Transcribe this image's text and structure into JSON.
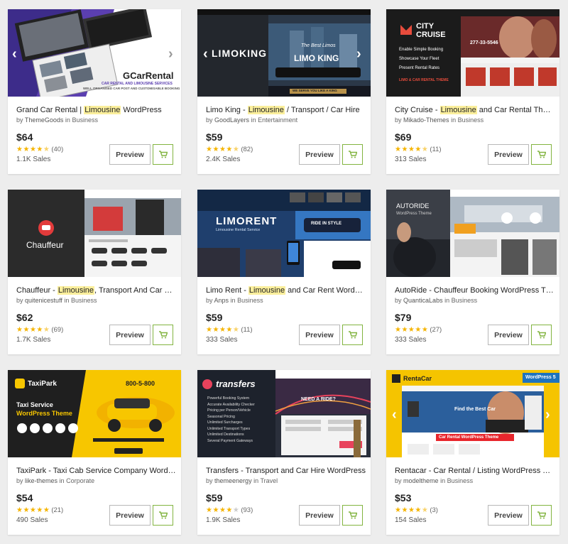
{
  "colors": {
    "accent_green": "#82b440",
    "star": "#f5b400",
    "highlight": "#fbef9c"
  },
  "button_labels": {
    "preview": "Preview",
    "cart_icon": "cart-icon"
  },
  "items": [
    {
      "title_pre": "Grand Car Rental | ",
      "title_hl": "Limousine",
      "title_post": " WordPress",
      "by": "by",
      "author": "ThemeGoods",
      "in": "in",
      "category": "Business",
      "price": "$64",
      "stars": "★★★★★",
      "rating_count": "(40)",
      "sales": "1.1K Sales",
      "rating": 4.5,
      "thumb": {
        "logo": "GCarRental",
        "sub1": "CAR RENTAL AND LIMOUSINE SERVICES",
        "sub2": "WELL ORGANISED CAR POST AND CUSTOMISABLE BOOKING"
      }
    },
    {
      "title_pre": "Limo King - ",
      "title_hl": "Limousine",
      "title_post": " / Transport / Car Hire",
      "by": "by",
      "author": "GoodLayers",
      "in": "in",
      "category": "Entertainment",
      "price": "$59",
      "stars": "★★★★★",
      "rating_count": "(82)",
      "sales": "2.4K Sales",
      "rating": 4.5,
      "thumb": {
        "logo": "LIMOKING",
        "sub1": "The Best Limos",
        "sub2": "LIMO KING",
        "sub3": "WE SERVE YOU LIKE A KING"
      }
    },
    {
      "title_pre": "City Cruise - ",
      "title_hl": "Limousine",
      "title_post": " and Car Rental Theme",
      "by": "by",
      "author": "Mikado-Themes",
      "in": "in",
      "category": "Business",
      "price": "$69",
      "stars": "★★★★★",
      "rating_count": "(11)",
      "sales": "313 Sales",
      "rating": 4.5,
      "thumb": {
        "logo1": "CITY",
        "logo2": "CRUISE",
        "l1": "Enable Simple Booking",
        "l2": "Showcase Your Fleet",
        "l3": "Present Rental Rates",
        "l4": "LIMO & CAR RENTAL THEME",
        "phone": "277-33-5546"
      }
    },
    {
      "title_pre": "Chauffeur - ",
      "title_hl": "Limousine",
      "title_post": ", Transport And Car Hire",
      "by": "by",
      "author": "quitenicestuff",
      "in": "in",
      "category": "Business",
      "price": "$62",
      "stars": "★★★★★",
      "rating_count": "(69)",
      "sales": "1.7K Sales",
      "rating": 4.5,
      "thumb": {
        "logo": "Chauffeur"
      }
    },
    {
      "title_pre": "Limo Rent - ",
      "title_hl": "Limousine",
      "title_post": " and Car Rent WordPress",
      "by": "by",
      "author": "Anps",
      "in": "in",
      "category": "Business",
      "price": "$59",
      "stars": "★★★★★",
      "rating_count": "(11)",
      "sales": "333 Sales",
      "rating": 4.5,
      "thumb": {
        "logo": "LIMORENT",
        "sub1": "Limousine Rental Service",
        "sub2": "RIDE IN STYLE"
      }
    },
    {
      "title_pre": "AutoRide - Chauffeur Booking WordPress Theme",
      "title_hl": "",
      "title_post": "",
      "by": "by",
      "author": "QuanticaLabs",
      "in": "in",
      "category": "Business",
      "price": "$79",
      "stars": "★★★★★",
      "rating_count": "(27)",
      "sales": "333 Sales",
      "rating": 5,
      "thumb": {
        "logo": "AUTORIDE",
        "sub1": "WordPress Theme"
      }
    },
    {
      "title_pre": "TaxiPark - Taxi Cab Service Company WordPress",
      "title_hl": "",
      "title_post": "",
      "by": "by",
      "author": "like-themes",
      "in": "in",
      "category": "Corporate",
      "price": "$54",
      "stars": "★★★★★",
      "rating_count": "(21)",
      "sales": "490 Sales",
      "rating": 5,
      "thumb": {
        "logo": "TaxiPark",
        "l1": "Taxi Service",
        "l2": "WordPress Theme",
        "phone": "800-5-800"
      }
    },
    {
      "title_pre": "Transfers - Transport and Car Hire WordPress",
      "title_hl": "",
      "title_post": "",
      "by": "by",
      "author": "themeenergy",
      "in": "in",
      "category": "Travel",
      "price": "$59",
      "stars": "★★★★★",
      "rating_count": "(93)",
      "sales": "1.9K Sales",
      "rating": 4,
      "thumb": {
        "logo": "transfers",
        "features": [
          "Powerful Booking System",
          "Accurate Availability Checker",
          "Pricing per Person/Vehicle",
          "Seasonal Pricing",
          "Unlimited Surcharges",
          "Unlimited Transport Types",
          "Unlimited Destinations",
          "Several Payment Gateways"
        ],
        "ride": "NEED A RIDE?"
      }
    },
    {
      "title_pre": "Rentacar - Car Rental / Listing WordPress Theme",
      "title_hl": "",
      "title_post": "",
      "by": "by",
      "author": "modeltheme",
      "in": "in",
      "category": "Business",
      "price": "$53",
      "stars": "★★★★★",
      "rating_count": "(3)",
      "sales": "154 Sales",
      "rating": 4.5,
      "thumb": {
        "logo": "RentaCar",
        "badge": "WordPress 5",
        "banner": "Car Rental WordPress Theme",
        "tag": "Find the Best Car"
      }
    }
  ]
}
